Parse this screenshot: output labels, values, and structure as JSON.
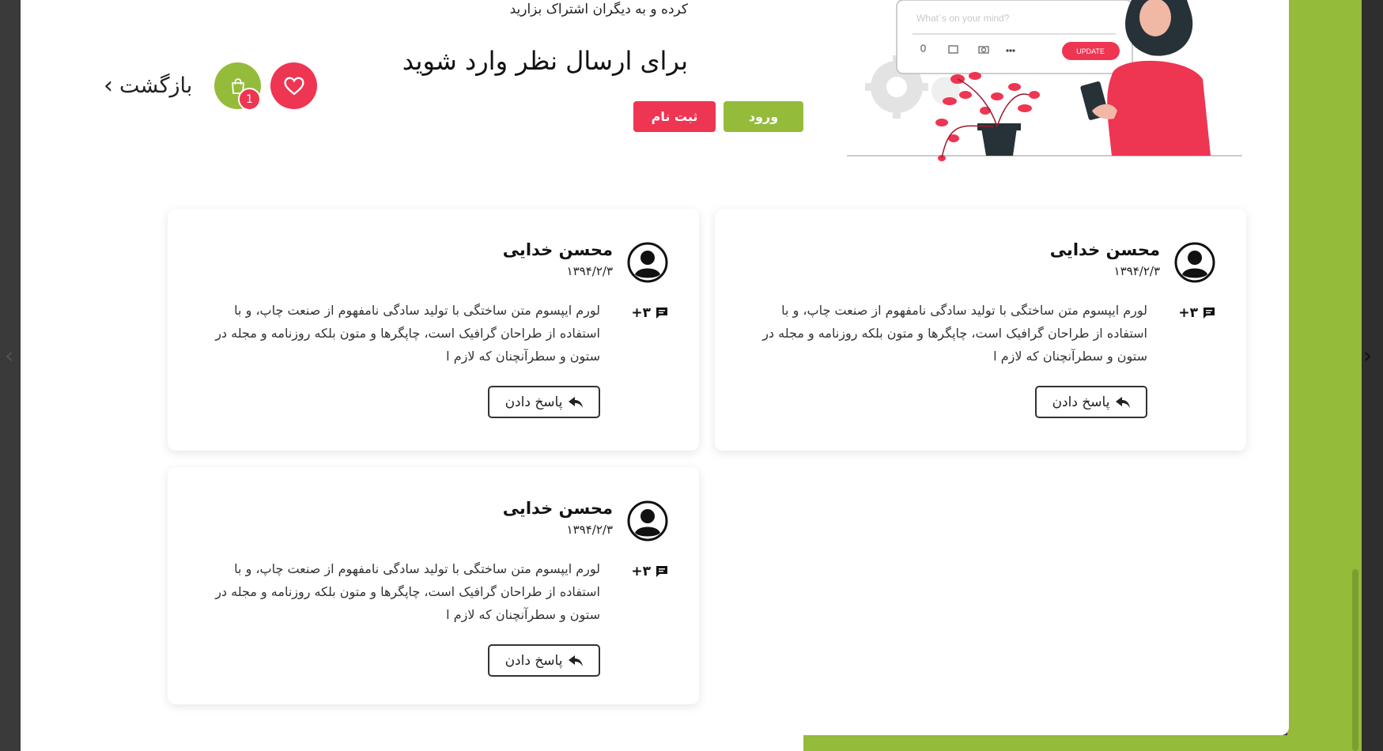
{
  "header": {
    "share_text": "کرده و به دیگران اشتراک بزارید",
    "heading": "برای ارسال نظر وارد شوید",
    "login_label": "ورود",
    "register_label": "ثبت نام",
    "back_label": "بازگشت",
    "cart_count": "1"
  },
  "illustration": {
    "post_placeholder": "What`s on your mind?",
    "update_label": "UPDATE"
  },
  "comments": [
    {
      "author": "محسن خدایی",
      "date": "۱۳۹۴/۲/۳",
      "reply_count": "۳+",
      "text": "لورم ایپسوم متن ساختگی با تولید سادگی نامفهوم از صنعت چاپ، و با استفاده از طراحان گرافیک است، چاپگرها و متون بلکه روزنامه و مجله در ستون و سطرآنچنان که لازم ا",
      "reply_label": "پاسخ دادن"
    },
    {
      "author": "محسن خدایی",
      "date": "۱۳۹۴/۲/۳",
      "reply_count": "۳+",
      "text": "لورم ایپسوم متن ساختگی با تولید سادگی نامفهوم از صنعت چاپ، و با استفاده از طراحان گرافیک است، چاپگرها و متون بلکه روزنامه و مجله در ستون و سطرآنچنان که لازم ا",
      "reply_label": "پاسخ دادن"
    },
    {
      "author": "محسن خدایی",
      "date": "۱۳۹۴/۲/۳",
      "reply_count": "۳+",
      "text": "لورم ایپسوم متن ساختگی با تولید سادگی نامفهوم از صنعت چاپ، و با استفاده از طراحان گرافیک است، چاپگرها و متون بلکه روزنامه و مجله در ستون و سطرآنچنان که لازم ا",
      "reply_label": "پاسخ دادن"
    }
  ],
  "colors": {
    "accent_green": "#95bb3a",
    "accent_red": "#ee3552"
  }
}
